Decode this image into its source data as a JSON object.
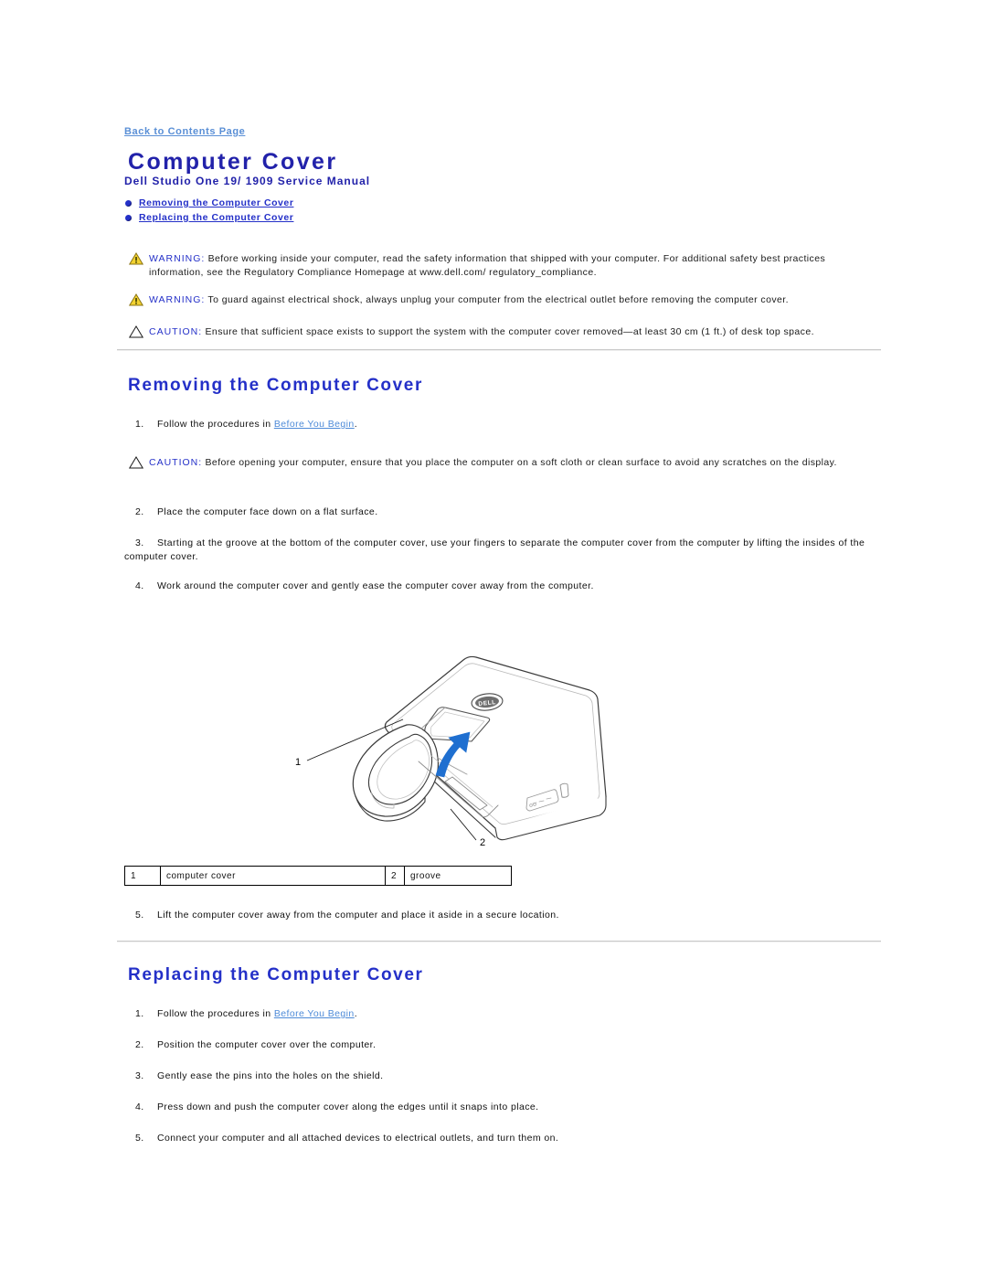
{
  "back_link": {
    "label": "Back to Contents Page",
    "icon": "back-link"
  },
  "title": "Computer Cover",
  "subtitle": "Dell Studio One 19/ 1909 Service Manual",
  "toc": {
    "items": [
      {
        "label": "Removing the Computer Cover",
        "bullet_icon": "bullet-dot-icon"
      },
      {
        "label": "Replacing the Computer Cover",
        "bullet_icon": "bullet-dot-icon"
      }
    ]
  },
  "admonitions": [
    {
      "icon": "warning-triangle-icon",
      "keyword": "WARNING:",
      "text": " Before working inside your computer, read the safety information that shipped with your computer. For additional safety best practices information, see the Regulatory Compliance Homepage at www.dell.com/ regulatory_compliance."
    },
    {
      "icon": "warning-triangle-icon",
      "keyword": "WARNING:",
      "text": " To guard against electrical shock, always unplug your computer from the electrical outlet before removing the computer cover."
    },
    {
      "icon": "caution-triangle-icon",
      "keyword": "CAUTION:",
      "text": " Ensure that sufficient space exists to support the system with the computer cover removed—at least 30 cm (1 ft.) of desk top space."
    },
    {
      "icon": "caution-triangle-icon",
      "keyword": "CAUTION:",
      "text": " Before opening your computer, ensure that you place the computer on a soft cloth or clean surface to avoid any scratches on the display."
    }
  ],
  "removing": {
    "heading": "Removing the Computer Cover",
    "steps": [
      {
        "num": "1.",
        "pre": "Follow the procedures in ",
        "link": "Before You Begin",
        "post": "."
      },
      {
        "num": "2.",
        "pre": "Place the computer face down on a flat surface.",
        "link": "",
        "post": ""
      },
      {
        "num": "3.",
        "pre": "Starting at the groove at the bottom of the computer cover, use your fingers to separate the computer cover from the computer by lifting the insides of the computer cover.",
        "link": "",
        "post": ""
      },
      {
        "num": "4.",
        "pre": "Work around the computer cover and gently ease the computer cover away from the computer.",
        "link": "",
        "post": ""
      },
      {
        "num": "5.",
        "pre": "Lift the computer cover away from the computer and place it aside in a secure location.",
        "link": "",
        "post": ""
      }
    ]
  },
  "figure": {
    "name": "computer-cover-removal-illustration",
    "callouts": [
      {
        "number": "1"
      },
      {
        "number": "2"
      }
    ],
    "arrow_color": "#1F6FD0",
    "logo_text": "DELL"
  },
  "legend": {
    "rows": [
      {
        "num1": "1",
        "label1": "computer cover",
        "num2": "2",
        "label2": "groove"
      }
    ]
  },
  "replacing": {
    "heading": "Replacing the Computer Cover",
    "steps": [
      {
        "num": "1.",
        "pre": "Follow the procedures in ",
        "link": "Before You Begin",
        "post": "."
      },
      {
        "num": "2.",
        "pre": "Position the computer cover over the computer.",
        "link": "",
        "post": ""
      },
      {
        "num": "3.",
        "pre": "Gently ease the pins into the holes on the shield.",
        "link": "",
        "post": ""
      },
      {
        "num": "4.",
        "pre": "Press down and push the computer cover along the edges until it snaps into place.",
        "link": "",
        "post": ""
      },
      {
        "num": "5.",
        "pre": "Connect your computer and all attached devices to electrical outlets, and turn them on.",
        "link": "",
        "post": ""
      }
    ]
  },
  "colors": {
    "heading_blue": "#2430C8",
    "title_blue": "#2222AA",
    "link_blue": "#4E8BD8",
    "warning_yellow": "#F2D231"
  }
}
